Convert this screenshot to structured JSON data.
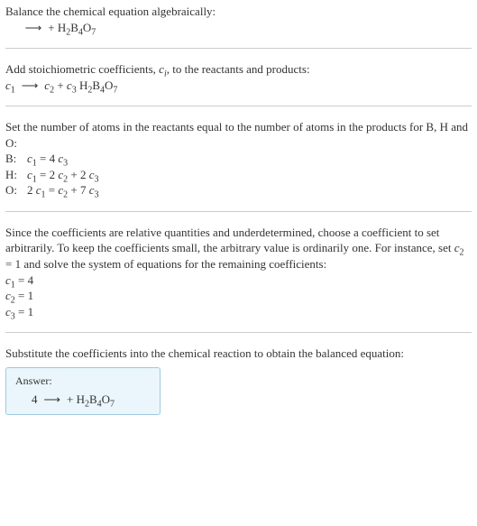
{
  "s1": {
    "line1": "Balance the chemical equation algebraically:",
    "arrow": "⟶",
    "plus": " + ",
    "H2B4O7": {
      "H": "H",
      "2": "2",
      "B": "B",
      "4": "4",
      "O": "O",
      "7": "7"
    }
  },
  "s2": {
    "line1a": "Add stoichiometric coefficients, ",
    "c": "c",
    "i": "i",
    "line1b": ", to the reactants and products:",
    "c1": "c",
    "n1": "1",
    "arrow": "⟶",
    "c2": "c",
    "n2": "2",
    "plus": " + ",
    "c3": "c",
    "n3": "3",
    "sp": " ",
    "H2B4O7": {
      "H": "H",
      "2": "2",
      "B": "B",
      "4": "4",
      "O": "O",
      "7": "7"
    }
  },
  "s3": {
    "line1": "Set the number of atoms in the reactants equal to the number of atoms in the products for B, H and O:",
    "rows": {
      "B": {
        "label": "B:",
        "c": "c",
        "n1": "1",
        "eq": " = 4 ",
        "n3": "3"
      },
      "H": {
        "label": "H:",
        "c": "c",
        "n1": "1",
        "eq1": " = 2 ",
        "n2": "2",
        "eq2": " + 2 ",
        "n3": "3"
      },
      "O": {
        "label": "O:",
        "two": "2 ",
        "c": "c",
        "n1": "1",
        "eq1": " = ",
        "n2": "2",
        "eq2": " + 7 ",
        "n3": "3"
      }
    }
  },
  "s4": {
    "line1a": "Since the coefficients are relative quantities and underdetermined, choose a coefficient to set arbitrarily. To keep the coefficients small, the arbitrary value is ordinarily one. For instance, set ",
    "c": "c",
    "n2": "2",
    "eq1": " = 1",
    "line1b": " and solve the system of equations for the remaining coefficients:",
    "r1": {
      "c": "c",
      "n": "1",
      "val": " = 4"
    },
    "r2": {
      "c": "c",
      "n": "2",
      "val": " = 1"
    },
    "r3": {
      "c": "c",
      "n": "3",
      "val": " = 1"
    }
  },
  "s5": {
    "line1": "Substitute the coefficients into the chemical reaction to obtain the balanced equation:",
    "answer_title": "Answer:",
    "four": "4 ",
    "arrow": "⟶",
    "plus": " + ",
    "H2B4O7": {
      "H": "H",
      "2": "2",
      "B": "B",
      "4": "4",
      "O": "O",
      "7": "7"
    }
  }
}
